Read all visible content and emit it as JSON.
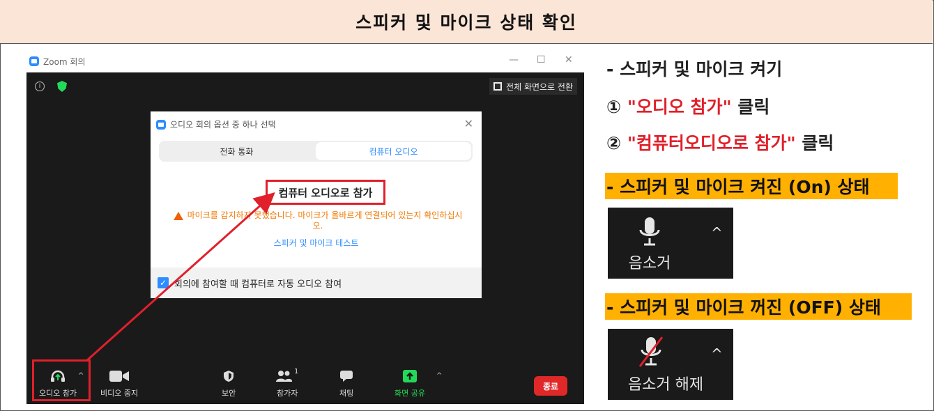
{
  "header": {
    "title": "스피커 및 마이크 상태 확인"
  },
  "zoom": {
    "window_title": "Zoom 회의",
    "fullscreen_label": "전체 화면으로 전환",
    "dialog": {
      "title": "오디오 회의 옵션 중 하나 선택",
      "tab_phone": "전화 통화",
      "tab_computer": "컴퓨터 오디오",
      "join_button": "컴퓨터 오디오로 참가",
      "warning": "마이크를 감지하지 못했습니다. 마이크가 올바르게 연결되어 있는지 확인하십시오.",
      "test_link": "스피커 및 마이크 테스트",
      "auto_join": "회의에 참여할 때 컴퓨터로 자동 오디오 참여"
    },
    "toolbar": {
      "audio": "오디오 참가",
      "video": "비디오 중지",
      "security": "보안",
      "participants": "참가자",
      "participants_count": "1",
      "chat": "채팅",
      "share": "화면 공유",
      "end": "종료"
    }
  },
  "right_panel": {
    "heading": "- 스피커 및 마이크 켜기",
    "step1_prefix": "① ",
    "step1_highlight": "\"오디오 참가\"",
    "step1_suffix": " 클릭",
    "step2_prefix": "② ",
    "step2_highlight": "\"컴퓨터오디오로 참가\"",
    "step2_suffix": " 클릭",
    "on_bar": "- 스피커 및 마이크 켜진 (On) 상태",
    "on_label": "음소거",
    "off_bar": "- 스피커 및 마이크 꺼진 (OFF) 상태",
    "off_label": "음소거 해제"
  },
  "colors": {
    "accent_red": "#e0202a",
    "zoom_blue": "#2d8cff",
    "highlight_orange": "#ffb000",
    "header_bg": "#fbe5d6"
  }
}
